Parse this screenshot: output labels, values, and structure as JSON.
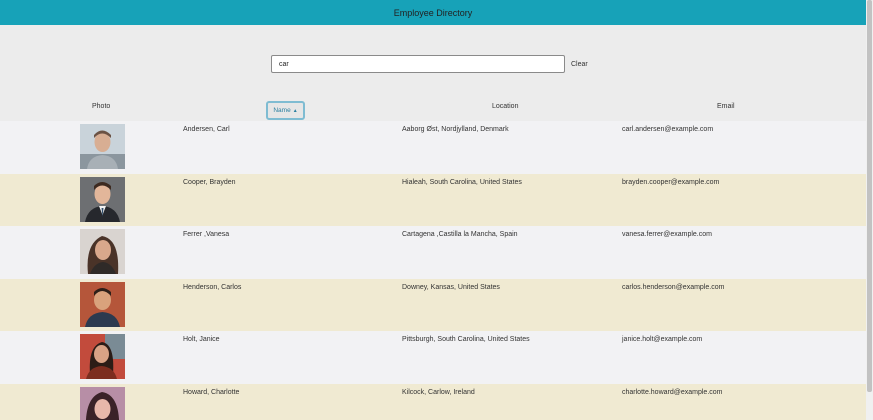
{
  "header": {
    "title": "Employee Directory"
  },
  "search": {
    "value": "car",
    "clear_label": "Clear"
  },
  "columns": {
    "photo": "Photo",
    "name": "Name",
    "sort_indicator": "▲",
    "location": "Location",
    "email": "Email"
  },
  "rows": [
    {
      "name": "Andersen, Carl",
      "location": "Aaborg Øst, Nordjylland, Denmark",
      "email": "carl.andersen@example.com"
    },
    {
      "name": "Cooper, Brayden",
      "location": "Hialeah, South Carolina, United States",
      "email": "brayden.cooper@example.com"
    },
    {
      "name": "Ferrer ,Vanesa",
      "location": "Cartagena ,Castilla la Mancha, Spain",
      "email": "vanesa.ferrer@example.com"
    },
    {
      "name": "Henderson, Carlos",
      "location": "Downey, Kansas, United States",
      "email": "carlos.henderson@example.com"
    },
    {
      "name": "Holt, Janice",
      "location": "Pittsburgh, South Carolina, United States",
      "email": "janice.holt@example.com"
    },
    {
      "name": "Howard, Charlotte",
      "location": "Kilcock, Carlow, Ireland",
      "email": "charlotte.howard@example.com"
    }
  ],
  "colors": {
    "header": "#17a2b8",
    "row_odd": "#f2f2f4",
    "row_even": "#f0ead2",
    "sort_border": "#7fbcd2"
  }
}
